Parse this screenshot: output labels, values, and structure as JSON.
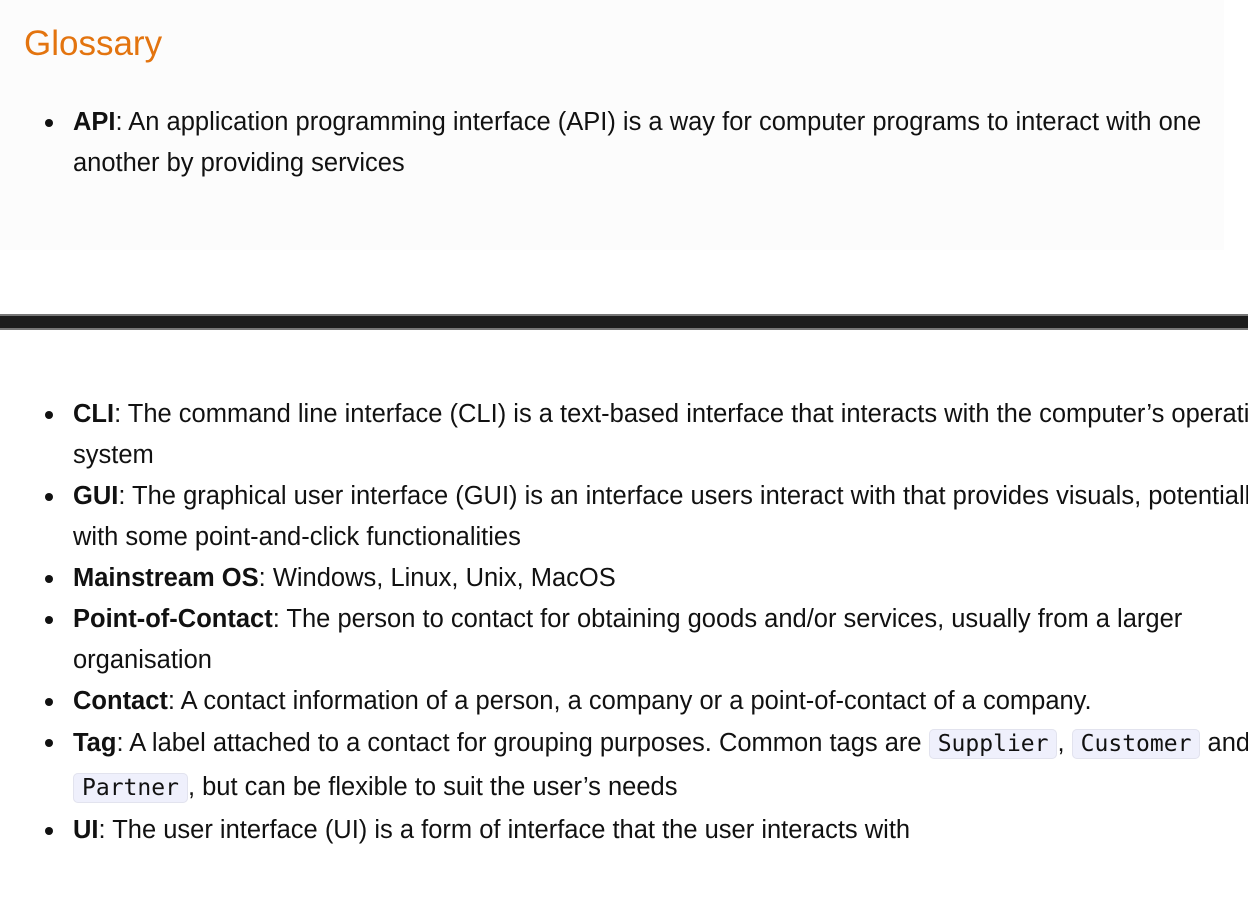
{
  "title": "Glossary",
  "top_items": [
    {
      "term": "API",
      "definition": ": An application programming interface (API) is a way for computer programs to interact with one another by providing services"
    }
  ],
  "items": [
    {
      "term": "CLI",
      "definition": ": The command line interface (CLI) is a text-based interface that interacts with the computer’s operating system"
    },
    {
      "term": "GUI",
      "definition": ": The graphical user interface (GUI) is an interface users interact with that provides visuals, potentially with some point-and-click functionalities"
    },
    {
      "term": "Mainstream OS",
      "definition": ": Windows, Linux, Unix, MacOS"
    },
    {
      "term": "Point-of-Contact",
      "definition": ": The person to contact for obtaining goods and/or services, usually from a larger organisation"
    },
    {
      "term": "Contact",
      "definition": ": A contact information of a person, a company or a point-of-contact of a company."
    },
    {
      "term": "UI",
      "definition": ": The user interface (UI) is a form of interface that the user interacts with"
    }
  ],
  "tag_item": {
    "term": "Tag",
    "text1": ": A label attached to a contact for grouping purposes. Common tags are ",
    "code1": "Supplier",
    "text2": ", ",
    "code2": "Customer",
    "text3": " and ",
    "code3": "Partner",
    "text4": ", but can be flexible to suit the user’s needs"
  }
}
